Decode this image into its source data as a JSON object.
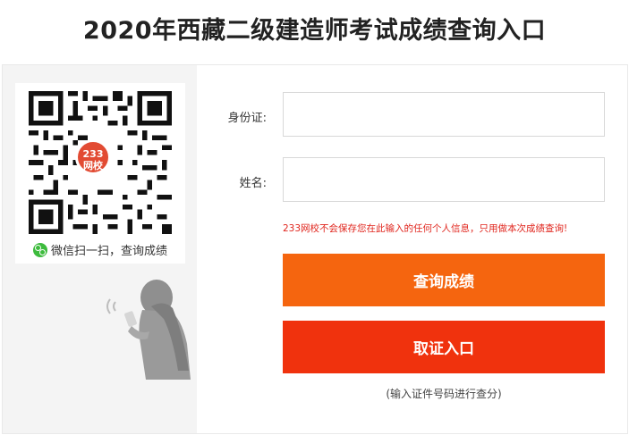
{
  "page": {
    "title": "2020年西藏二级建造师考试成绩查询入口"
  },
  "qr_panel": {
    "logo_line1": "233",
    "logo_line2": "网校",
    "caption": "微信扫一扫，查询成绩",
    "caption_icon": "wechat-icon",
    "illustration": "person-with-phone"
  },
  "form": {
    "id_label": "身份证:",
    "id_value": "",
    "name_label": "姓名:",
    "name_value": "",
    "privacy_notice": "233网校不会保存您在此输入的任何个人信息，只用做本次成绩查询!",
    "query_button": "查询成绩",
    "cert_button": "取证入口",
    "cert_hint": "(输入证件号码进行查分)"
  },
  "colors": {
    "query_button": "#f5650f",
    "cert_button": "#f0320d",
    "notice": "#e0251d",
    "left_panel": "#f4f4f4"
  }
}
